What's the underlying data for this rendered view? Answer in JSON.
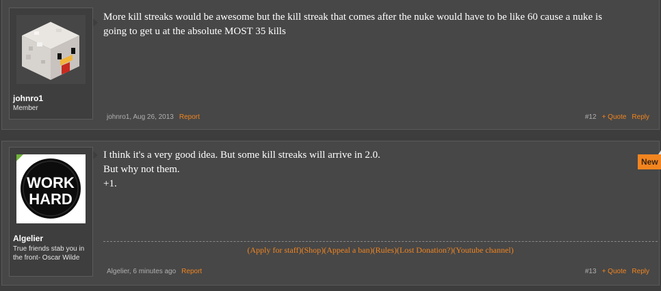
{
  "posts": [
    {
      "author": "johnro1",
      "title": "Member",
      "message": [
        "More kill streaks would be awesome but the kill streak that comes after the nuke would have to be like 60 cause a nuke is",
        "going to get u at the absolute MOST 35 kills"
      ],
      "meta": "johnro1, Aug 26, 2013",
      "report": "Report",
      "number": "#12",
      "quote": "+ Quote",
      "reply": "Reply"
    },
    {
      "author": "Algelier",
      "title": "True friends stab you in the front- Oscar Wilde",
      "message": [
        "I think it's a very good idea. But some kill streaks will arrive in 2.0.",
        "But why not them.",
        "+1."
      ],
      "avatar_text": [
        "WORK",
        "HARD"
      ],
      "signature_links": [
        "Apply for staff",
        "Shop",
        "Appeal a ban",
        "Rules",
        "Lost Donation?",
        "Youtube channel"
      ],
      "meta": "Algelier, 6 minutes ago",
      "report": "Report",
      "number": "#13",
      "quote": "+ Quote",
      "reply": "Reply",
      "new_badge": "New"
    }
  ],
  "colors": {
    "accent": "#f2851f",
    "background": "#3d3d3d",
    "post_background": "#474747"
  }
}
